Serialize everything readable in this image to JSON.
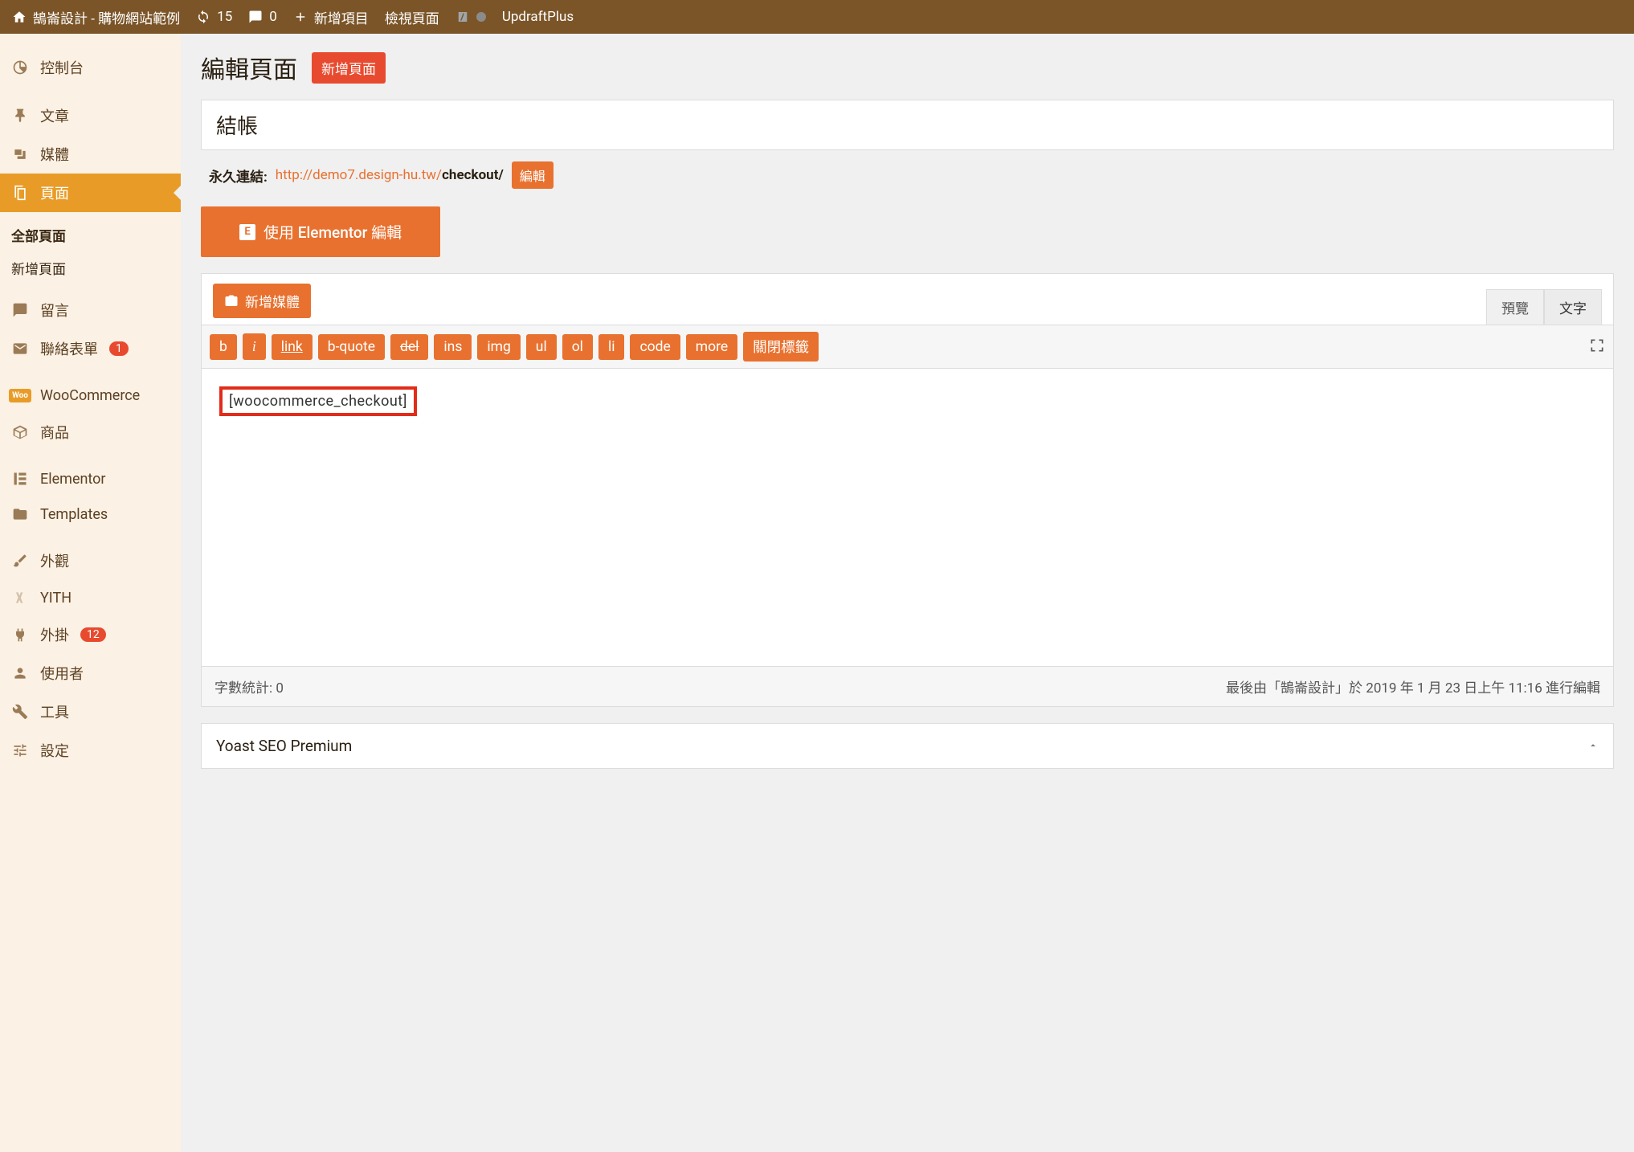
{
  "topbar": {
    "site_name": "鵠崙設計 - 購物網站範例",
    "updates_count": "15",
    "comments_count": "0",
    "new_item": "新增項目",
    "view_page": "檢視頁面",
    "updraft": "UpdraftPlus"
  },
  "sidebar": {
    "dashboard": "控制台",
    "posts": "文章",
    "media": "媒體",
    "pages": "頁面",
    "all_pages": "全部頁面",
    "new_page": "新增頁面",
    "comments": "留言",
    "contact_forms": "聯絡表單",
    "contact_badge": "1",
    "woocommerce": "WooCommerce",
    "products": "商品",
    "elementor": "Elementor",
    "templates": "Templates",
    "appearance": "外觀",
    "yith": "YITH",
    "plugins": "外掛",
    "plugins_badge": "12",
    "users": "使用者",
    "tools": "工具",
    "settings": "設定"
  },
  "header": {
    "title": "編輯頁面",
    "add_new": "新增頁面"
  },
  "title_input": "結帳",
  "permalink": {
    "label": "永久連結:",
    "url_base": "http://demo7.design-hu.tw/",
    "url_slug": "checkout/",
    "edit": "編輯"
  },
  "elementor_btn": "使用 Elementor 編輯",
  "media_btn": "新增媒體",
  "tabs": {
    "visual": "預覽",
    "text": "文字"
  },
  "toolbar": {
    "b": "b",
    "i": "i",
    "link": "link",
    "bquote": "b-quote",
    "del": "del",
    "ins": "ins",
    "img": "img",
    "ul": "ul",
    "ol": "ol",
    "li": "li",
    "code": "code",
    "more": "more",
    "close": "關閉標籤"
  },
  "editor_content": "[woocommerce_checkout]",
  "footer": {
    "word_count": "字數統計: 0",
    "last_edit": "最後由「鵠崙設計」於 2019 年 1 月 23 日上午 11:16 進行編輯"
  },
  "metabox": {
    "yoast": "Yoast SEO Premium"
  }
}
